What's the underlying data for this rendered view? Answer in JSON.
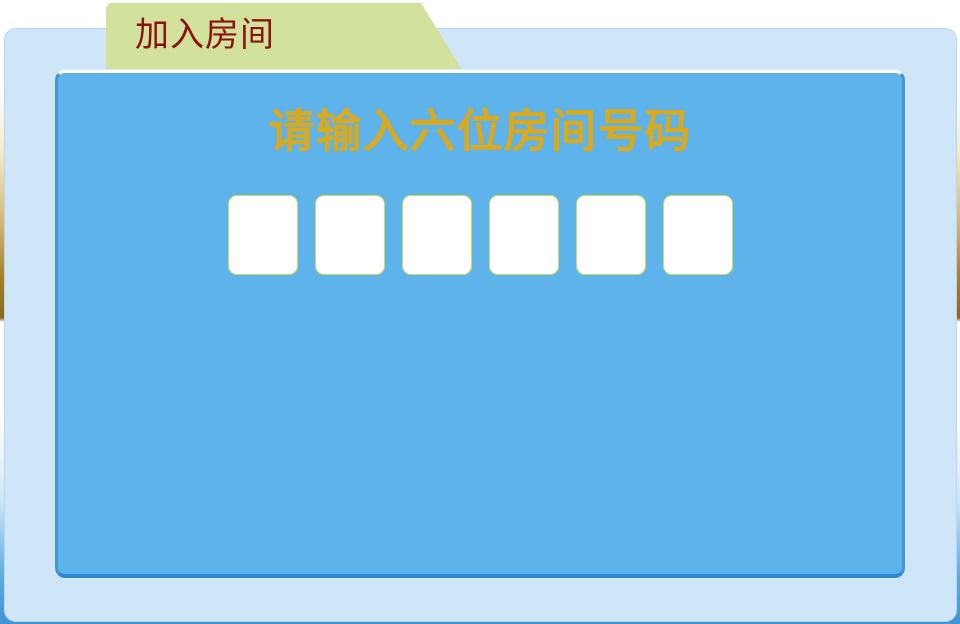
{
  "tab": {
    "title": "加入房间"
  },
  "prompt": {
    "text": "请输入六位房间号码"
  },
  "room_code": {
    "digits": [
      "",
      "",
      "",
      "",
      "",
      ""
    ]
  },
  "colors": {
    "tab_background": "#d2e29c",
    "tab_title": "#8b1212",
    "panel": "#5eb3ea",
    "frame": "#cfe5f8",
    "prompt_text": "#d9a920",
    "digit_border": "#c7e05a"
  }
}
